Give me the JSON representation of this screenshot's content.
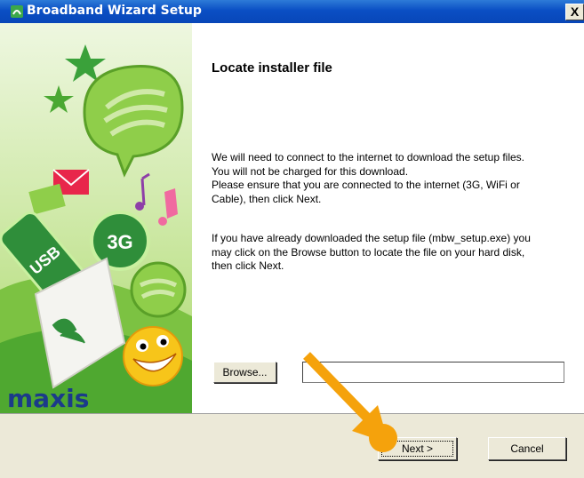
{
  "window": {
    "title": "Broadband Wizard Setup",
    "close_label": "X"
  },
  "banner": {
    "usb_label": "USB",
    "badge_label": "3G",
    "brand": "maxis"
  },
  "content": {
    "heading": "Locate installer file",
    "para1": [
      "We will need to connect to the internet to download the setup files.",
      "You will not be charged for this download.",
      "Please ensure that you are connected to the internet (3G, WiFi or",
      "Cable), then click Next."
    ],
    "para2": [
      "If you have already downloaded the setup file (mbw_setup.exe) you",
      "may click on the Browse button to locate the file on your hard disk,",
      "then click Next."
    ],
    "browse_label": "Browse...",
    "file_path_value": ""
  },
  "buttons": {
    "next_label": "Next >",
    "cancel_label": "Cancel"
  },
  "colors": {
    "title_bar": "#0a4fc4",
    "button_face": "#ece9d8",
    "annotation": "#f5a20c"
  }
}
